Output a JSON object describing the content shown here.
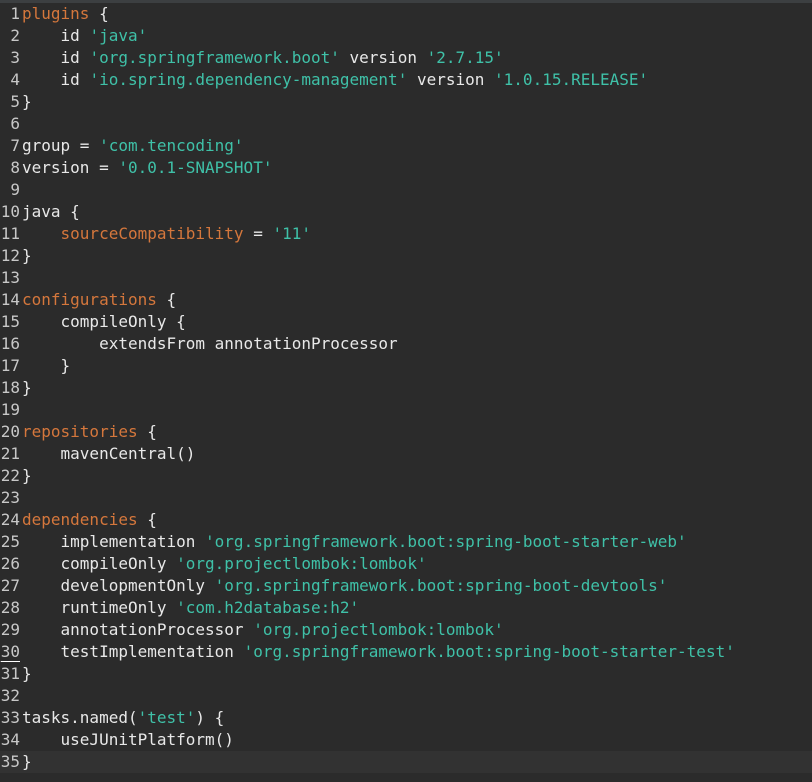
{
  "editor": {
    "current_line": 30,
    "colors": {
      "background": "#2b2b2b",
      "keyword": "#d5773c",
      "string": "#3fc1a8",
      "text": "#e8e8e8",
      "gutter": "#c8c8c8"
    },
    "lines": [
      {
        "n": "1",
        "tokens": [
          {
            "t": "plugins",
            "k": "kw"
          },
          {
            "t": " {",
            "k": "plain"
          }
        ]
      },
      {
        "n": "2",
        "tokens": [
          {
            "t": "    id ",
            "k": "plain"
          },
          {
            "t": "'java'",
            "k": "str"
          }
        ]
      },
      {
        "n": "3",
        "tokens": [
          {
            "t": "    id ",
            "k": "plain"
          },
          {
            "t": "'org.springframework.boot'",
            "k": "str"
          },
          {
            "t": " version ",
            "k": "plain"
          },
          {
            "t": "'2.7.15'",
            "k": "str"
          }
        ]
      },
      {
        "n": "4",
        "tokens": [
          {
            "t": "    id ",
            "k": "plain"
          },
          {
            "t": "'io.spring.dependency-management'",
            "k": "str"
          },
          {
            "t": " version ",
            "k": "plain"
          },
          {
            "t": "'1.0.15.RELEASE'",
            "k": "str"
          }
        ]
      },
      {
        "n": "5",
        "tokens": [
          {
            "t": "}",
            "k": "plain"
          }
        ]
      },
      {
        "n": "6",
        "tokens": []
      },
      {
        "n": "7",
        "tokens": [
          {
            "t": "group = ",
            "k": "plain"
          },
          {
            "t": "'com.tencoding'",
            "k": "str"
          }
        ]
      },
      {
        "n": "8",
        "tokens": [
          {
            "t": "version = ",
            "k": "plain"
          },
          {
            "t": "'0.0.1-SNAPSHOT'",
            "k": "str"
          }
        ]
      },
      {
        "n": "9",
        "tokens": []
      },
      {
        "n": "10",
        "tokens": [
          {
            "t": "java {",
            "k": "plain"
          }
        ]
      },
      {
        "n": "11",
        "tokens": [
          {
            "t": "    ",
            "k": "plain"
          },
          {
            "t": "sourceCompatibility",
            "k": "kw"
          },
          {
            "t": " = ",
            "k": "plain"
          },
          {
            "t": "'11'",
            "k": "str"
          }
        ]
      },
      {
        "n": "12",
        "tokens": [
          {
            "t": "}",
            "k": "plain"
          }
        ]
      },
      {
        "n": "13",
        "tokens": []
      },
      {
        "n": "14",
        "tokens": [
          {
            "t": "configurations",
            "k": "kw"
          },
          {
            "t": " {",
            "k": "plain"
          }
        ]
      },
      {
        "n": "15",
        "tokens": [
          {
            "t": "    compileOnly {",
            "k": "plain"
          }
        ]
      },
      {
        "n": "16",
        "tokens": [
          {
            "t": "        extendsFrom annotationProcessor",
            "k": "plain"
          }
        ]
      },
      {
        "n": "17",
        "tokens": [
          {
            "t": "    }",
            "k": "plain"
          }
        ]
      },
      {
        "n": "18",
        "tokens": [
          {
            "t": "}",
            "k": "plain"
          }
        ]
      },
      {
        "n": "19",
        "tokens": []
      },
      {
        "n": "20",
        "tokens": [
          {
            "t": "repositories",
            "k": "kw"
          },
          {
            "t": " {",
            "k": "plain"
          }
        ]
      },
      {
        "n": "21",
        "tokens": [
          {
            "t": "    mavenCentral()",
            "k": "plain"
          }
        ]
      },
      {
        "n": "22",
        "tokens": [
          {
            "t": "}",
            "k": "plain"
          }
        ]
      },
      {
        "n": "23",
        "tokens": []
      },
      {
        "n": "24",
        "tokens": [
          {
            "t": "dependencies",
            "k": "kw"
          },
          {
            "t": " {",
            "k": "plain"
          }
        ]
      },
      {
        "n": "25",
        "tokens": [
          {
            "t": "    implementation ",
            "k": "plain"
          },
          {
            "t": "'org.springframework.boot:spring-boot-starter-web'",
            "k": "str"
          }
        ]
      },
      {
        "n": "26",
        "tokens": [
          {
            "t": "    compileOnly ",
            "k": "plain"
          },
          {
            "t": "'org.projectlombok:lombok'",
            "k": "str"
          }
        ]
      },
      {
        "n": "27",
        "tokens": [
          {
            "t": "    developmentOnly ",
            "k": "plain"
          },
          {
            "t": "'org.springframework.boot:spring-boot-devtools'",
            "k": "str"
          }
        ]
      },
      {
        "n": "28",
        "tokens": [
          {
            "t": "    runtimeOnly ",
            "k": "plain"
          },
          {
            "t": "'com.h2database:h2'",
            "k": "str"
          }
        ]
      },
      {
        "n": "29",
        "tokens": [
          {
            "t": "    annotationProcessor ",
            "k": "plain"
          },
          {
            "t": "'org.projectlombok:lombok'",
            "k": "str"
          }
        ]
      },
      {
        "n": "30",
        "tokens": [
          {
            "t": "    testImplementation ",
            "k": "plain"
          },
          {
            "t": "'org.springframework.boot:spring-boot-starter-test'",
            "k": "str"
          }
        ]
      },
      {
        "n": "31",
        "tokens": [
          {
            "t": "}",
            "k": "plain"
          }
        ]
      },
      {
        "n": "32",
        "tokens": []
      },
      {
        "n": "33",
        "tokens": [
          {
            "t": "tasks.named(",
            "k": "plain"
          },
          {
            "t": "'test'",
            "k": "str"
          },
          {
            "t": ") {",
            "k": "plain"
          }
        ]
      },
      {
        "n": "34",
        "tokens": [
          {
            "t": "    useJUnitPlatform()",
            "k": "plain"
          }
        ]
      },
      {
        "n": "35",
        "tokens": [
          {
            "t": "}",
            "k": "plain"
          }
        ]
      }
    ]
  }
}
